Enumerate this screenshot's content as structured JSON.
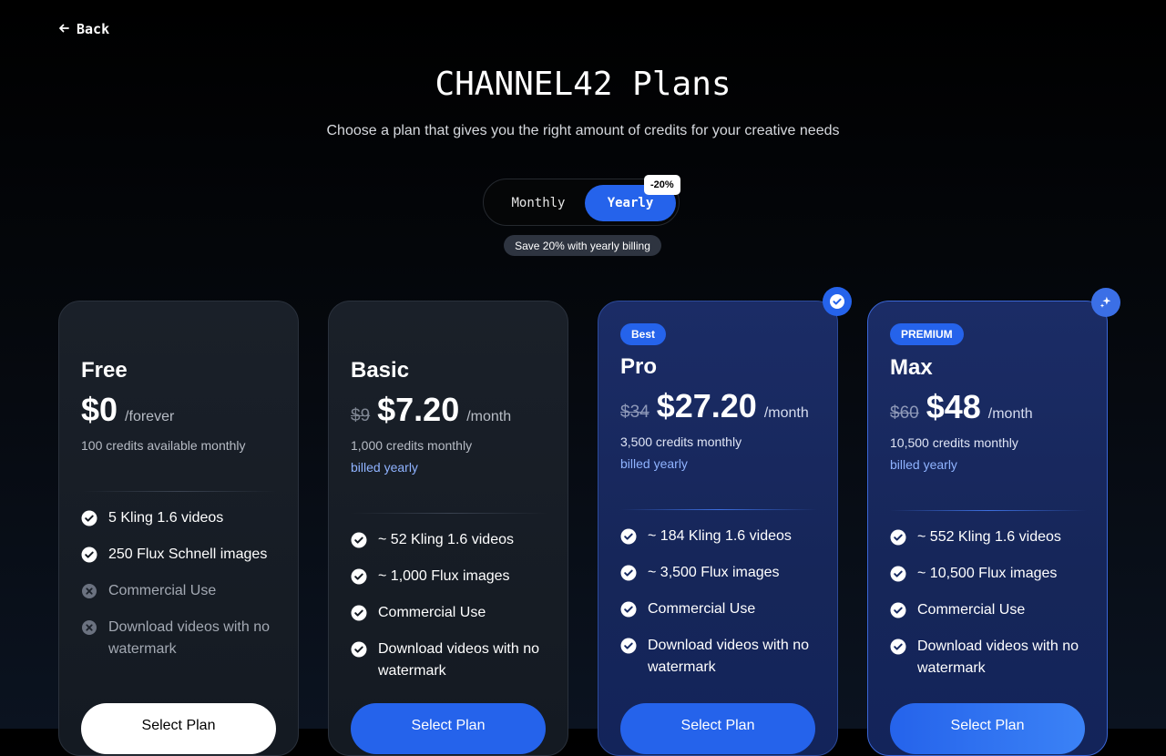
{
  "nav": {
    "back_label": "Back"
  },
  "header": {
    "title": "CHANNEL42 Plans",
    "subtitle": "Choose a plan that gives you the right amount of credits for your creative needs"
  },
  "billing_toggle": {
    "monthly_label": "Monthly",
    "yearly_label": "Yearly",
    "selected": "Yearly",
    "discount_badge": "-20%",
    "save_note": "Save 20% with yearly billing"
  },
  "colors": {
    "accent": "#2563eb",
    "billed_text": "#8fb3ff",
    "check": "#ffffff",
    "disabled_x": "#6b7280"
  },
  "plans": [
    {
      "name": "Free",
      "old_price": "",
      "price": "$0",
      "period": "/forever",
      "credits": "100 credits available monthly",
      "billed": "",
      "badge": "",
      "features": [
        {
          "text": "5 Kling 1.6 videos",
          "included": true,
          "icon": "check-circle-icon"
        },
        {
          "text": "250 Flux Schnell images",
          "included": true,
          "icon": "check-circle-icon"
        },
        {
          "text": "Commercial Use",
          "included": false,
          "icon": "x-circle-icon"
        },
        {
          "text": "Download videos with no watermark",
          "included": false,
          "icon": "x-circle-icon"
        }
      ],
      "button_label": "Select Plan"
    },
    {
      "name": "Basic",
      "old_price": "$9",
      "price": "$7.20",
      "period": "/month",
      "credits": "1,000 credits monthly",
      "billed": "billed yearly",
      "badge": "",
      "features": [
        {
          "text": "~ 52 Kling 1.6 videos",
          "included": true,
          "icon": "check-circle-icon"
        },
        {
          "text": "~ 1,000 Flux images",
          "included": true,
          "icon": "check-circle-icon"
        },
        {
          "text": "Commercial Use",
          "included": true,
          "icon": "check-circle-icon"
        },
        {
          "text": "Download videos with no watermark",
          "included": true,
          "icon": "check-circle-icon"
        }
      ],
      "button_label": "Select Plan"
    },
    {
      "name": "Pro",
      "old_price": "$34",
      "price": "$27.20",
      "period": "/month",
      "credits": "3,500 credits monthly",
      "billed": "billed yearly",
      "badge": "Best",
      "corner_icon": "check-badge-icon",
      "features": [
        {
          "text": "~ 184 Kling 1.6 videos",
          "included": true,
          "icon": "check-circle-icon"
        },
        {
          "text": "~ 3,500 Flux images",
          "included": true,
          "icon": "check-circle-icon"
        },
        {
          "text": "Commercial Use",
          "included": true,
          "icon": "check-circle-icon"
        },
        {
          "text": "Download videos with no watermark",
          "included": true,
          "icon": "check-circle-icon"
        }
      ],
      "button_label": "Select Plan"
    },
    {
      "name": "Max",
      "old_price": "$60",
      "price": "$48",
      "period": "/month",
      "credits": "10,500 credits monthly",
      "billed": "billed yearly",
      "badge": "PREMIUM",
      "corner_icon": "sparkles-icon",
      "features": [
        {
          "text": "~ 552 Kling 1.6 videos",
          "included": true,
          "icon": "check-circle-icon"
        },
        {
          "text": "~ 10,500 Flux images",
          "included": true,
          "icon": "check-circle-icon"
        },
        {
          "text": "Commercial Use",
          "included": true,
          "icon": "check-circle-icon"
        },
        {
          "text": "Download videos with no watermark",
          "included": true,
          "icon": "check-circle-icon"
        }
      ],
      "button_label": "Select Plan"
    }
  ]
}
